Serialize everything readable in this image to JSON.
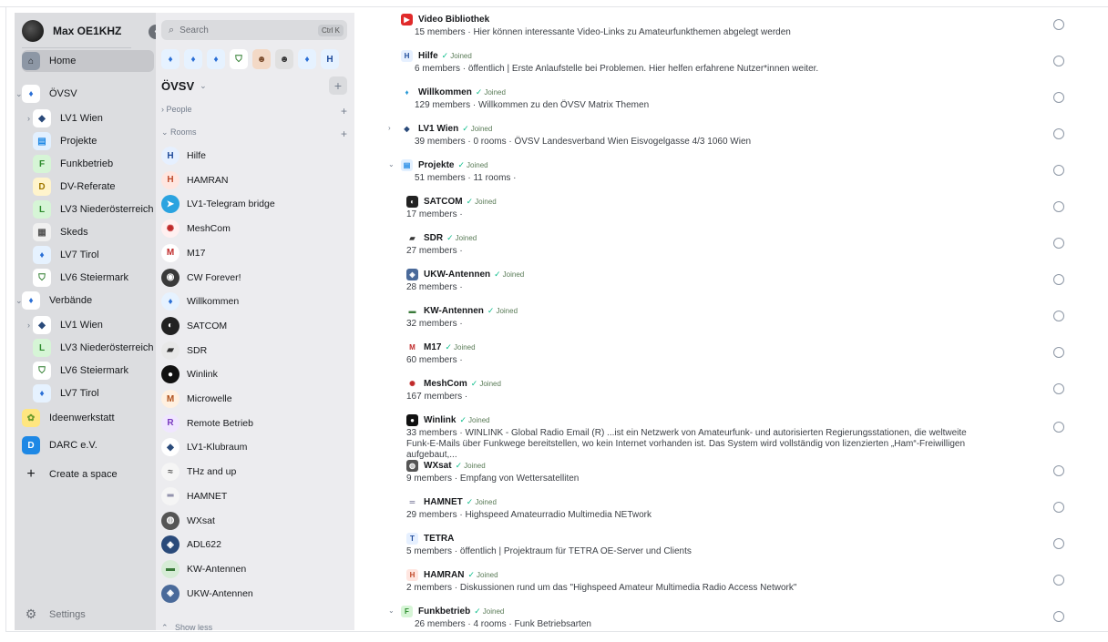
{
  "user": {
    "name": "Max OE1KHZ"
  },
  "spaces": [
    {
      "label": "Home",
      "icon": "home-icon",
      "type": "home",
      "color": "#8d97a5",
      "fg": "#17191c"
    },
    {
      "label": "ÖVSV",
      "icon": "oevsv-icon",
      "type": "space",
      "color": "#ffffff",
      "fg": "#2a6fd6",
      "glyph": "♦"
    },
    {
      "label": "LV1 Wien",
      "icon": "lv1-wien-icon",
      "type": "sub",
      "color": "#ffffff",
      "fg": "#2a4a7a",
      "glyph": "◆"
    },
    {
      "label": "Projekte",
      "icon": "projekte-icon",
      "type": "sub",
      "color": "#e2f0ff",
      "fg": "#1e88e5",
      "glyph": "▤"
    },
    {
      "label": "Funkbetrieb",
      "icon": "funkbetrieb-icon",
      "type": "sub",
      "color": "#d6f5d6",
      "fg": "#2a8a2a",
      "glyph": "F"
    },
    {
      "label": "DV-Referate",
      "icon": "dv-referate-icon",
      "type": "sub",
      "color": "#fff4cc",
      "fg": "#a07800",
      "glyph": "D"
    },
    {
      "label": "LV3 Niederösterreich",
      "icon": "lv3-icon",
      "type": "sub",
      "color": "#d6f5d6",
      "fg": "#2a8a2a",
      "glyph": "L"
    },
    {
      "label": "Skeds",
      "icon": "skeds-icon",
      "type": "sub",
      "color": "#f0f0f0",
      "fg": "#555555",
      "glyph": "▦"
    },
    {
      "label": "LV7 Tirol",
      "icon": "lv7-tirol-icon",
      "type": "sub",
      "color": "#e6f2ff",
      "fg": "#2a6fd6",
      "glyph": "♦"
    },
    {
      "label": "LV6 Steiermark",
      "icon": "lv6-steiermark-icon",
      "type": "sub",
      "color": "#ffffff",
      "fg": "#2a7a2a",
      "glyph": "⛉"
    },
    {
      "label": "Verbände",
      "icon": "verbaende-icon",
      "type": "space",
      "color": "#ffffff",
      "fg": "#2a6fd6",
      "glyph": "♦"
    },
    {
      "label": "LV1 Wien",
      "icon": "lv1-wien-icon",
      "type": "sub",
      "color": "#ffffff",
      "fg": "#2a4a7a",
      "glyph": "◆"
    },
    {
      "label": "LV3 Niederösterreich",
      "icon": "lv3-icon",
      "type": "sub",
      "color": "#d6f5d6",
      "fg": "#2a8a2a",
      "glyph": "L"
    },
    {
      "label": "LV6 Steiermark",
      "icon": "lv6-steiermark-icon",
      "type": "sub",
      "color": "#ffffff",
      "fg": "#2a7a2a",
      "glyph": "⛉"
    },
    {
      "label": "LV7 Tirol",
      "icon": "lv7-tirol-icon",
      "type": "sub",
      "color": "#e6f2ff",
      "fg": "#2a6fd6",
      "glyph": "♦"
    },
    {
      "label": "Ideenwerkstatt",
      "icon": "ideenwerkstatt-icon",
      "type": "space",
      "color": "#ffe680",
      "fg": "#6a9a2a",
      "glyph": "✿"
    },
    {
      "label": "DARC e.V.",
      "icon": "darc-icon",
      "type": "space",
      "color": "#1e88e5",
      "fg": "#ffffff",
      "glyph": "D"
    },
    {
      "label": "Create a space",
      "icon": "plus-icon",
      "type": "create"
    }
  ],
  "settings_label": "Settings",
  "search": {
    "placeholder": "Search",
    "shortcut": "Ctrl K"
  },
  "breadcrumbs": [
    {
      "glyph": "♦",
      "bg": "#e6f2ff",
      "fg": "#2a6fd6"
    },
    {
      "glyph": "♦",
      "bg": "#e6f2ff",
      "fg": "#2a6fd6"
    },
    {
      "glyph": "♦",
      "bg": "#e6f2ff",
      "fg": "#2a6fd6"
    },
    {
      "glyph": "⛉",
      "bg": "#ffffff",
      "fg": "#2a7a2a"
    },
    {
      "glyph": "☻",
      "bg": "#f3d9c6",
      "fg": "#7a4a2a"
    },
    {
      "glyph": "☻",
      "bg": "#e0e0e0",
      "fg": "#333333"
    },
    {
      "glyph": "♦",
      "bg": "#e6f2ff",
      "fg": "#2a6fd6"
    },
    {
      "glyph": "H",
      "bg": "#e6f2ff",
      "fg": "#1e4a9a"
    }
  ],
  "space_title": "ÖVSV",
  "sections": {
    "people": "People",
    "rooms": "Rooms"
  },
  "rooms": [
    {
      "name": "Hilfe",
      "glyph": "H",
      "bg": "#e6f0ff",
      "fg": "#1e4a9a"
    },
    {
      "name": "HAMRAN",
      "glyph": "H",
      "bg": "#ffe6e0",
      "fg": "#c04a2a"
    },
    {
      "name": "LV1-Telegram bridge",
      "glyph": "➤",
      "bg": "#2aa3e0",
      "fg": "#ffffff"
    },
    {
      "name": "MeshCom",
      "glyph": "✺",
      "bg": "#fff0f0",
      "fg": "#c02a2a"
    },
    {
      "name": "M17",
      "glyph": "M",
      "bg": "#ffffff",
      "fg": "#c02a2a"
    },
    {
      "name": "CW Forever!",
      "glyph": "◉",
      "bg": "#3a3a3a",
      "fg": "#ffffff"
    },
    {
      "name": "Willkommen",
      "glyph": "♦",
      "bg": "#e6f2ff",
      "fg": "#2a6fd6"
    },
    {
      "name": "SATCOM",
      "glyph": "◐",
      "bg": "#222222",
      "fg": "#ffffff"
    },
    {
      "name": "SDR",
      "glyph": "▰",
      "bg": "#e8e8e8",
      "fg": "#333333"
    },
    {
      "name": "Winlink",
      "glyph": "●",
      "bg": "#111111",
      "fg": "#ffffff"
    },
    {
      "name": "Microwelle",
      "glyph": "M",
      "bg": "#fff0e0",
      "fg": "#b0501a"
    },
    {
      "name": "Remote Betrieb",
      "glyph": "R",
      "bg": "#f0e6ff",
      "fg": "#7a3ac0"
    },
    {
      "name": "LV1-Klubraum",
      "glyph": "◆",
      "bg": "#ffffff",
      "fg": "#2a4a7a"
    },
    {
      "name": "THz and up",
      "glyph": "≈",
      "bg": "#f5f5f5",
      "fg": "#555555"
    },
    {
      "name": "HAMNET",
      "glyph": "═",
      "bg": "#f5f5f5",
      "fg": "#333366"
    },
    {
      "name": "WXsat",
      "glyph": "◍",
      "bg": "#555555",
      "fg": "#ffffff"
    },
    {
      "name": "ADL622",
      "glyph": "◈",
      "bg": "#2a4a7a",
      "fg": "#ffffff"
    },
    {
      "name": "KW-Antennen",
      "glyph": "▬",
      "bg": "#d6ecd6",
      "fg": "#3a7a3a"
    },
    {
      "name": "UKW-Antennen",
      "glyph": "◈",
      "bg": "#4a6a9a",
      "fg": "#ffffff"
    }
  ],
  "show_less": "Show less",
  "hierarchy": [
    {
      "name": "Video Bibliothek",
      "joined": false,
      "desc": "15 members · Hier können interessante Video-Links zu Amateurfunkthemen abgelegt werden",
      "glyph": "▶",
      "bg": "#e02a2a",
      "fg": "#ffffff",
      "child": false,
      "expander": ""
    },
    {
      "name": "Hilfe",
      "joined": true,
      "desc": "6 members · öffentlich | Erste Anlaufstelle bei Problemen. Hier helfen erfahrene Nutzer*innen weiter.",
      "glyph": "H",
      "bg": "#e6f0ff",
      "fg": "#1e4a9a",
      "child": false,
      "expander": ""
    },
    {
      "name": "Willkommen",
      "joined": true,
      "desc": "129 members · Willkommen zu den ÖVSV Matrix Themen",
      "glyph": "♦",
      "bg": "#ffffff",
      "fg": "#2a9ad6",
      "child": false,
      "expander": ""
    },
    {
      "name": "LV1 Wien",
      "joined": true,
      "desc": "39 members · 0 rooms · ÖVSV Landesverband Wien Eisvogelgasse 4/3 1060 Wien",
      "glyph": "◆",
      "bg": "#ffffff",
      "fg": "#2a4a7a",
      "child": false,
      "expander": "›"
    },
    {
      "name": "Projekte",
      "joined": true,
      "desc": "51 members · 11 rooms ·",
      "glyph": "▤",
      "bg": "#e2f0ff",
      "fg": "#1e88e5",
      "child": false,
      "expander": "⌄"
    },
    {
      "name": "SATCOM",
      "joined": true,
      "desc": "17 members ·",
      "glyph": "◐",
      "bg": "#222222",
      "fg": "#ffffff",
      "child": true,
      "expander": ""
    },
    {
      "name": "SDR",
      "joined": true,
      "desc": "27 members ·",
      "glyph": "▰",
      "bg": "#ffffff",
      "fg": "#333333",
      "child": true,
      "expander": ""
    },
    {
      "name": "UKW-Antennen",
      "joined": true,
      "desc": "28 members ·",
      "glyph": "◈",
      "bg": "#4a6a9a",
      "fg": "#ffffff",
      "child": true,
      "expander": ""
    },
    {
      "name": "KW-Antennen",
      "joined": true,
      "desc": "32 members ·",
      "glyph": "▬",
      "bg": "#ffffff",
      "fg": "#3a7a3a",
      "child": true,
      "expander": ""
    },
    {
      "name": "M17",
      "joined": true,
      "desc": "60 members ·",
      "glyph": "M",
      "bg": "#ffffff",
      "fg": "#c02a2a",
      "child": true,
      "expander": ""
    },
    {
      "name": "MeshCom",
      "joined": true,
      "desc": "167 members ·",
      "glyph": "✺",
      "bg": "#ffffff",
      "fg": "#c02a2a",
      "child": true,
      "expander": ""
    },
    {
      "name": "Winlink",
      "joined": true,
      "desc": "33 members · WINLINK - Global Radio Email (R) ...ist ein Netzwerk von Amateurfunk- und autorisierten Regierungsstationen, die weltweite Funk-E-Mails über Funkwege bereitstellen, wo kein Internet vorhanden ist. Das System wird vollständig von lizenzierten „Ham“-Freiwilligen aufgebaut,...",
      "glyph": "●",
      "bg": "#111111",
      "fg": "#ffffff",
      "child": true,
      "expander": ""
    },
    {
      "name": "WXsat",
      "joined": true,
      "desc": "9 members · Empfang von Wettersatelliten",
      "glyph": "◍",
      "bg": "#555555",
      "fg": "#ffffff",
      "child": true,
      "expander": ""
    },
    {
      "name": "HAMNET",
      "joined": true,
      "desc": "29 members · Highspeed Amateurradio Multimedia NETwork",
      "glyph": "═",
      "bg": "#ffffff",
      "fg": "#333366",
      "child": true,
      "expander": ""
    },
    {
      "name": "TETRA",
      "joined": false,
      "desc": "5 members · öffentlich | Projektraum für TETRA OE-Server und Clients",
      "glyph": "T",
      "bg": "#e6f0ff",
      "fg": "#1e4a9a",
      "child": true,
      "expander": ""
    },
    {
      "name": "HAMRAN",
      "joined": true,
      "desc": "2 members · Diskussionen rund um das \"Highspeed Amateur Multimedia Radio Access Network\"",
      "glyph": "H",
      "bg": "#ffe6e0",
      "fg": "#c04a2a",
      "child": true,
      "expander": ""
    },
    {
      "name": "Funkbetrieb",
      "joined": true,
      "desc": "26 members · 4 rooms · Funk Betriebsarten",
      "glyph": "F",
      "bg": "#d6f5d6",
      "fg": "#2a8a2a",
      "child": false,
      "expander": "⌄"
    }
  ],
  "joined_label": "Joined"
}
